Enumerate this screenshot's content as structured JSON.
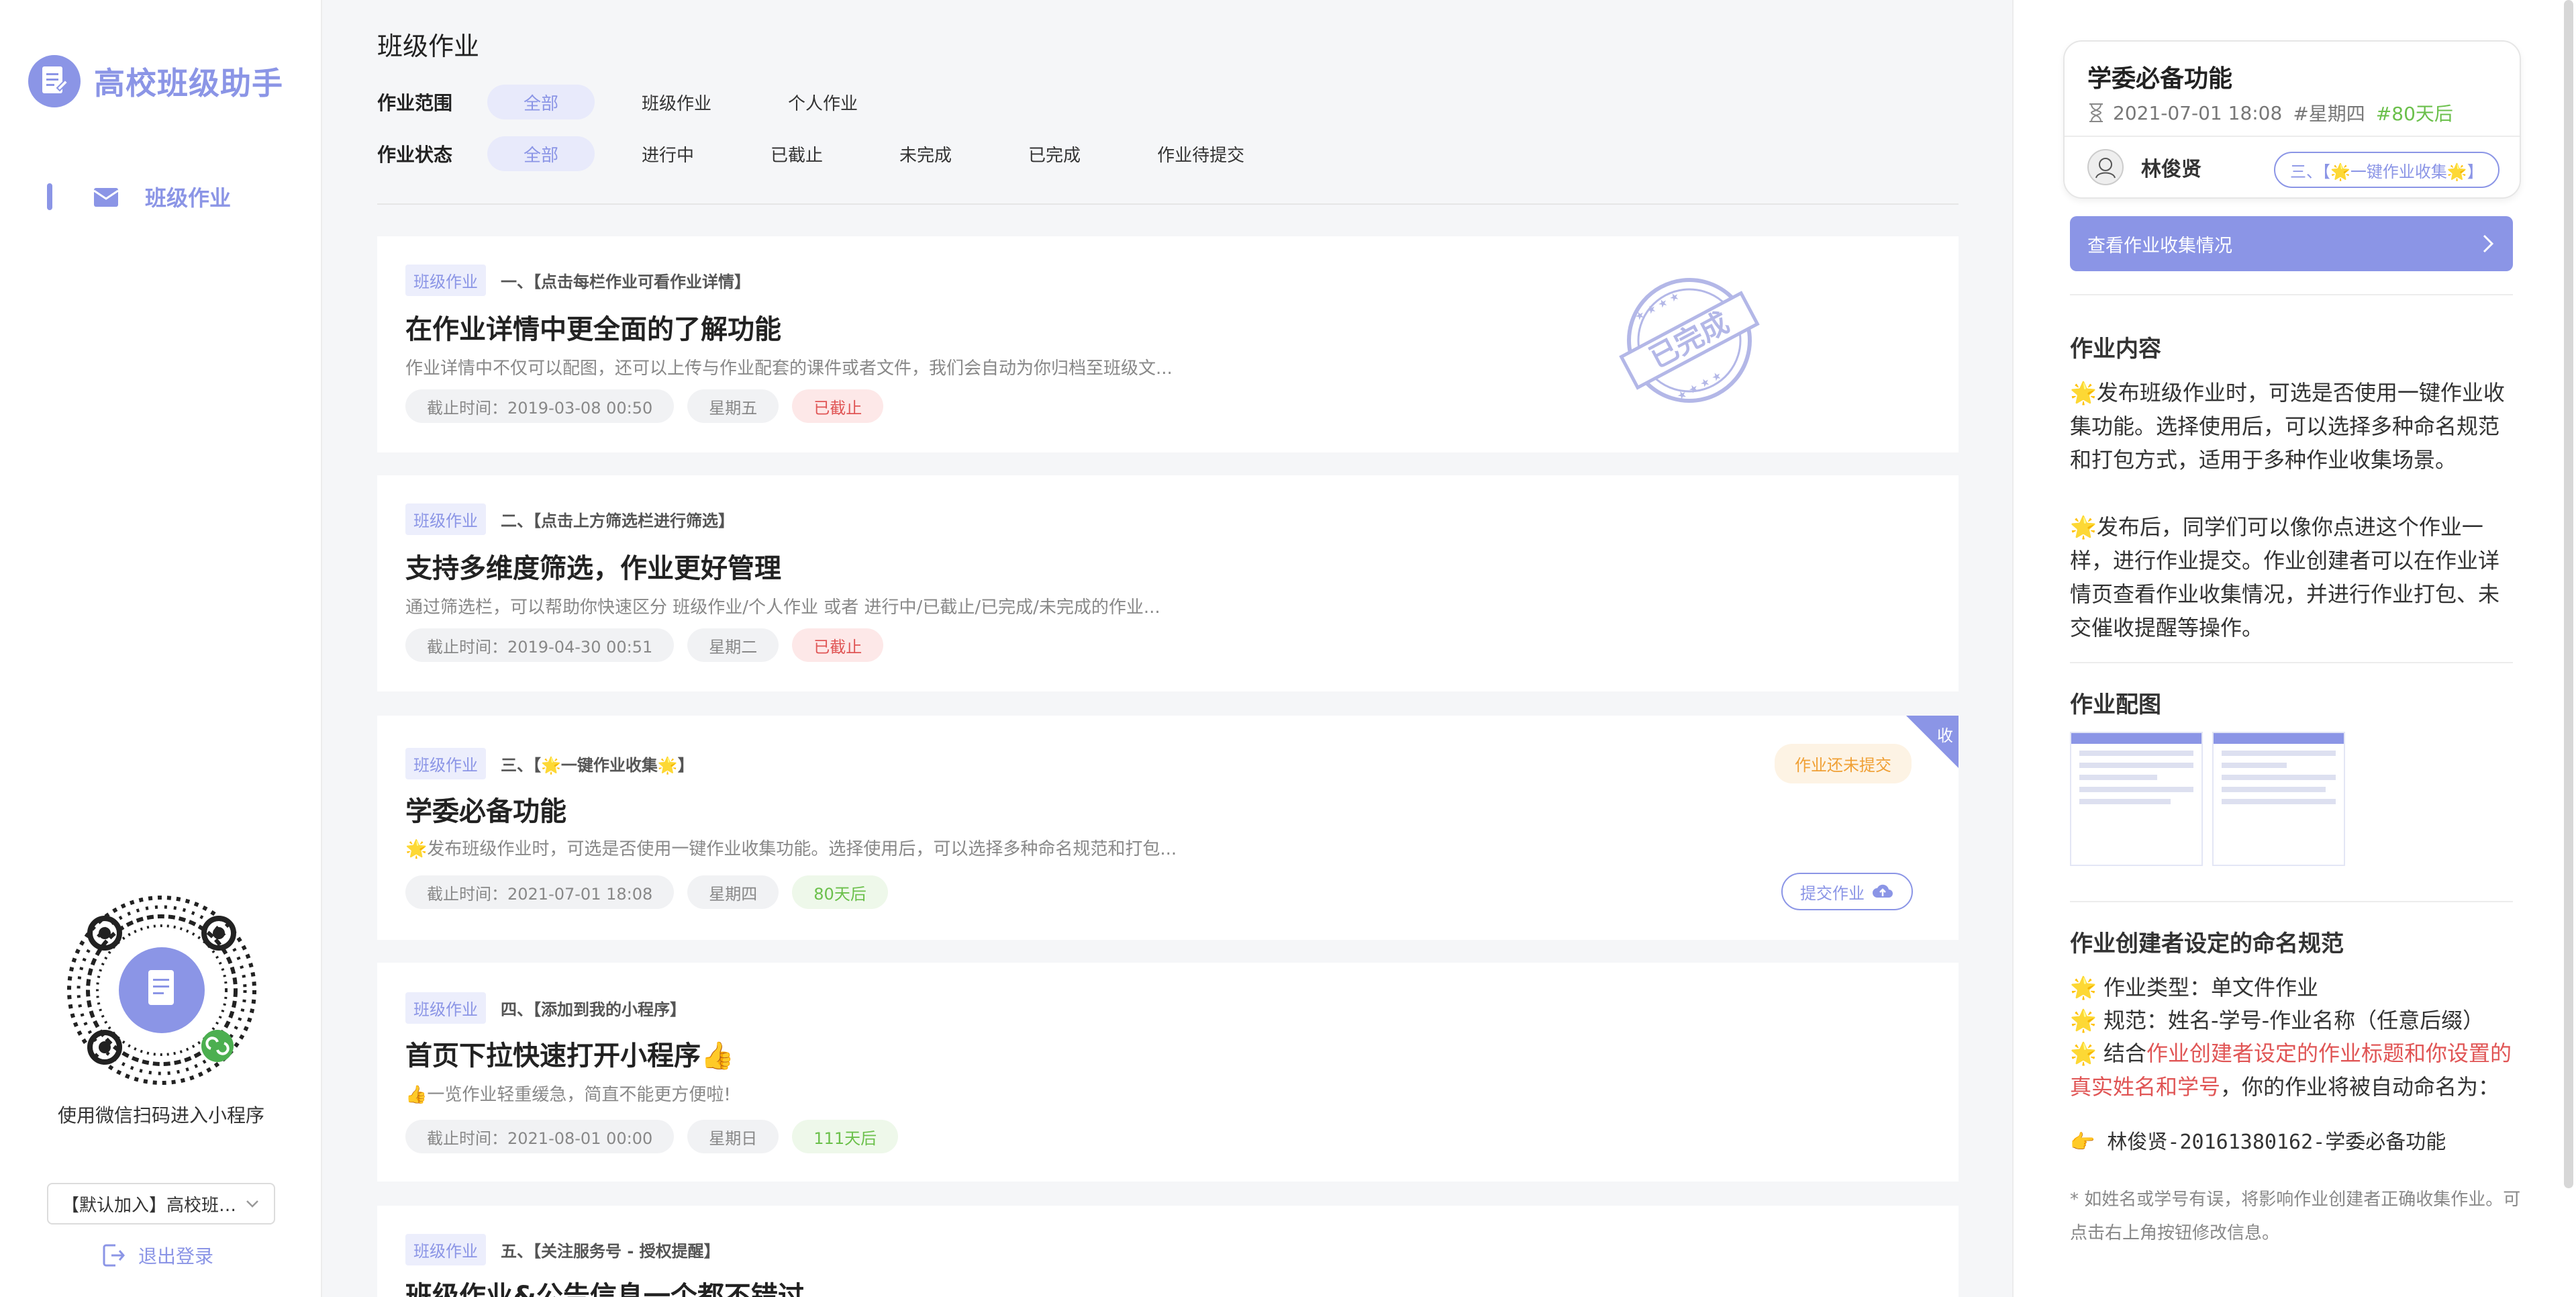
{
  "brand": {
    "name": "高校班级助手"
  },
  "sidebar": {
    "nav": [
      {
        "label": "班级作业"
      }
    ],
    "qr_caption": "使用微信扫码进入小程序",
    "class_select": "【默认加入】高校班级助手",
    "logout": "退出登录"
  },
  "main": {
    "title": "班级作业",
    "filters": {
      "scope_label": "作业范围",
      "scope_options": [
        "全部",
        "班级作业",
        "个人作业"
      ],
      "status_label": "作业状态",
      "status_options": [
        "全部",
        "进行中",
        "已截止",
        "未完成",
        "已完成",
        "作业待提交"
      ]
    },
    "cards": [
      {
        "tag": "班级作业",
        "seq": "一、【点击每栏作业可看作业详情】",
        "title": "在作业详情中更全面的了解功能",
        "desc": "作业详情中不仅可以配图，还可以上传与作业配套的课件或者文件，我们会自动为你归档至班级文...",
        "deadline": "截止时间：2019-03-08 00:50",
        "weekday": "星期五",
        "status": "已截止",
        "stamp": "已完成"
      },
      {
        "tag": "班级作业",
        "seq": "二、【点击上方筛选栏进行筛选】",
        "title": "支持多维度筛选，作业更好管理",
        "desc": "通过筛选栏，可以帮助你快速区分 班级作业/个人作业 或者 进行中/已截止/已完成/未完成的作业...",
        "deadline": "截止时间：2019-04-30 00:51",
        "weekday": "星期二",
        "status": "已截止"
      },
      {
        "tag": "班级作业",
        "seq": "三、【🌟一键作业收集🌟】",
        "title": "学委必备功能",
        "desc": "🌟发布班级作业时，可选是否使用一键作业收集功能。选择使用后，可以选择多种命名规范和打包...",
        "deadline": "截止时间：2021-07-01 18:08",
        "weekday": "星期四",
        "status": "80天后",
        "tip": "作业还未提交",
        "submit": "提交作业",
        "corner": "收"
      },
      {
        "tag": "班级作业",
        "seq": "四、【添加到我的小程序】",
        "title": "首页下拉快速打开小程序👍",
        "desc": "👍一览作业轻重缓急，简直不能更方便啦!",
        "deadline": "截止时间：2021-08-01 00:00",
        "weekday": "星期日",
        "status": "111天后"
      },
      {
        "tag": "班级作业",
        "seq": "五、【关注服务号 - 授权提醒】",
        "title": "班级作业&公告信息一个都不错过"
      }
    ]
  },
  "detail": {
    "title": "学委必备功能",
    "date": "2021-07-01 18:08",
    "weekday": "#星期四",
    "countdown": "#80天后",
    "user": "林俊贤",
    "chip": "三、【🌟一键作业收集🌟】",
    "view_btn": "查看作业收集情况",
    "content_h": "作业内容",
    "content_p1": "🌟发布班级作业时，可选是否使用一键作业收集功能。选择使用后，可以选择多种命名规范和打包方式，适用于多种作业收集场景。",
    "content_p2": "🌟发布后，同学们可以像你点进这个作业一样，进行作业提交。作业创建者可以在作业详情页查看作业收集情况，并进行作业打包、未交催收提醒等操作。",
    "images_h": "作业配图",
    "rule_h": "作业创建者设定的命名规范",
    "rule_type": "🌟 作业类型：单文件作业",
    "rule_spec": "🌟 规范：姓名-学号-作业名称（任意后缀）",
    "rule_combine_a": "🌟 结合",
    "rule_combine_red": "作业创建者设定的作业标题和你设置的真实姓名和学号",
    "rule_combine_b": "，你的作业将被自动命名为：",
    "final_name": "👉  林俊贤-20161380162-学委必备功能",
    "note": "* 如姓名或学号有误，将影响作业创建者正确收集作业。可点击右上角按钮修改信息。"
  },
  "colors": {
    "accent": "#8b95e6",
    "danger": "#e05555",
    "success": "#6bc04b",
    "warning": "#f0a035"
  }
}
